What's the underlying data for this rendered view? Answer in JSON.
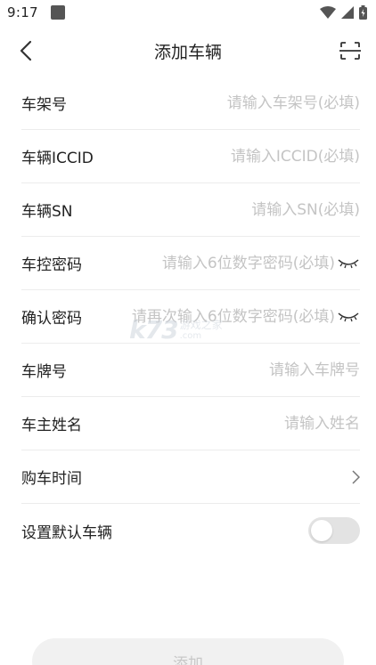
{
  "status_bar": {
    "time": "9:17"
  },
  "header": {
    "title": "添加车辆",
    "back_icon": "chevron-left-icon",
    "scan_icon": "scan-icon"
  },
  "form": {
    "vin": {
      "label": "车架号",
      "placeholder": "请输入车架号(必填)",
      "value": ""
    },
    "iccid": {
      "label": "车辆ICCID",
      "placeholder": "请输入ICCID(必填)",
      "value": ""
    },
    "sn": {
      "label": "车辆SN",
      "placeholder": "请输入SN(必填)",
      "value": ""
    },
    "password": {
      "label": "车控密码",
      "placeholder": "请输入6位数字密码(必填)",
      "value": ""
    },
    "confirm_password": {
      "label": "确认密码",
      "placeholder": "请再次输入6位数字密码(必填)",
      "value": ""
    },
    "plate": {
      "label": "车牌号",
      "placeholder": "请输入车牌号",
      "value": ""
    },
    "owner": {
      "label": "车主姓名",
      "placeholder": "请输入姓名",
      "value": ""
    },
    "purchase_time": {
      "label": "购车时间"
    },
    "default_vehicle": {
      "label": "设置默认车辆",
      "enabled": false
    }
  },
  "submit": {
    "label": "添加"
  },
  "watermark": {
    "logo": "k73",
    "line1": "游戏之家",
    "line2": ".com"
  },
  "colors": {
    "placeholder": "#c4c4c4",
    "divider": "#ececec",
    "toggle_off": "#e3e3e3",
    "button_bg": "#f1f1f1"
  }
}
